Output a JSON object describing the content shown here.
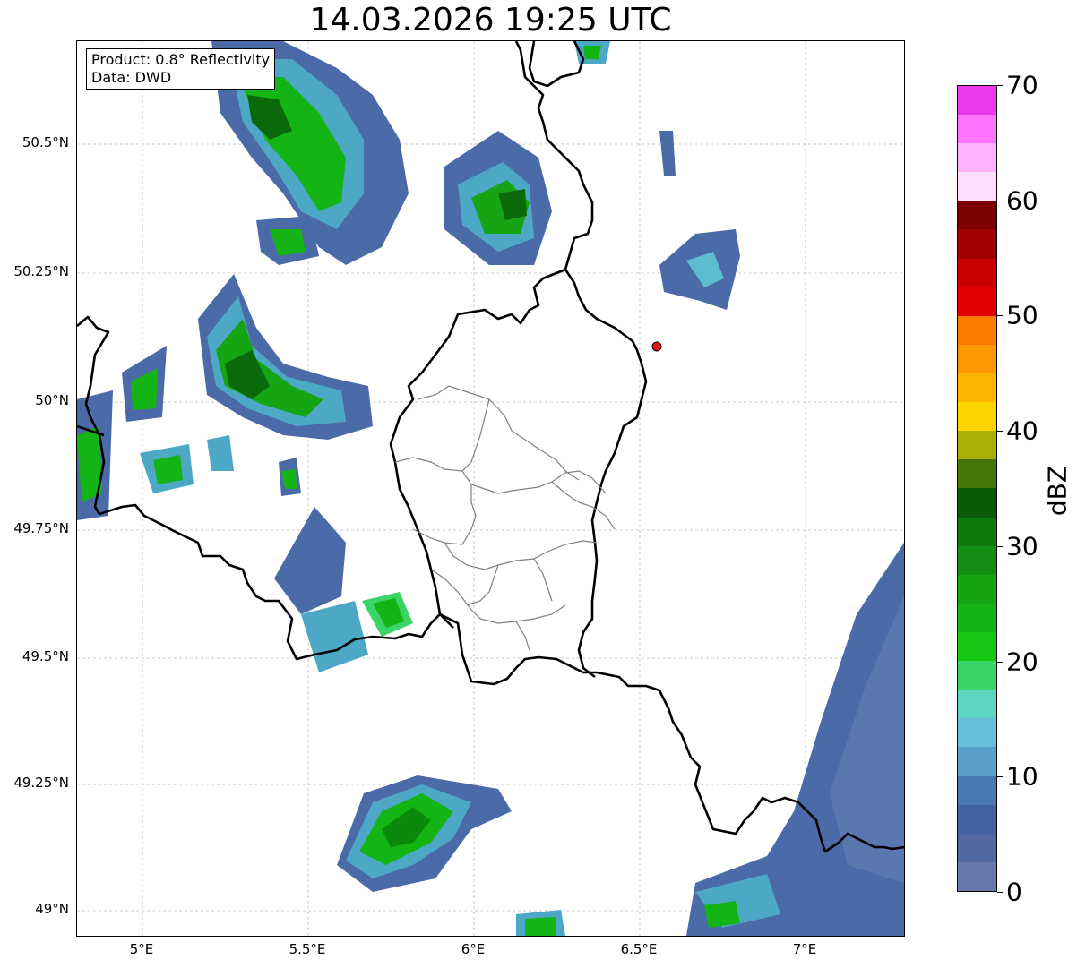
{
  "title": "14.03.2026 19:25 UTC",
  "info": {
    "product": "Product: 0.8° Reflectivity",
    "data": "Data: DWD"
  },
  "map": {
    "lon_range": [
      4.8,
      7.3
    ],
    "lat_range": [
      48.95,
      50.65
    ],
    "x_ticks": [
      "5°E",
      "5.5°E",
      "6°E",
      "6.5°E",
      "7°E"
    ],
    "y_ticks": [
      "50.5°N",
      "50.25°N",
      "50°N",
      "49.75°N",
      "49.5°N",
      "49.25°N",
      "49°N"
    ],
    "radar_site_color": "#ee1111",
    "border_color": "#000000",
    "district_border_color": "#808080"
  },
  "colorbar": {
    "unit": "dBZ",
    "min": 0,
    "max": 70,
    "labels": [
      "0",
      "10",
      "20",
      "30",
      "40",
      "50",
      "60",
      "70"
    ],
    "colors": [
      "#6878aa",
      "#5068a0",
      "#4262a4",
      "#4a78b4",
      "#58a0c8",
      "#66c0dc",
      "#5cd6c0",
      "#3cd468",
      "#14c814",
      "#14b414",
      "#14a414",
      "#128e12",
      "#0e7a0e",
      "#0a5a0a",
      "#46760a",
      "#aab00a",
      "#fed400",
      "#fdb400",
      "#fd9800",
      "#fd7a00",
      "#e40000",
      "#c80000",
      "#a00000",
      "#7c0000",
      "#fee0fe",
      "#feb2fe",
      "#fe74fe",
      "#ea38ea"
    ]
  }
}
